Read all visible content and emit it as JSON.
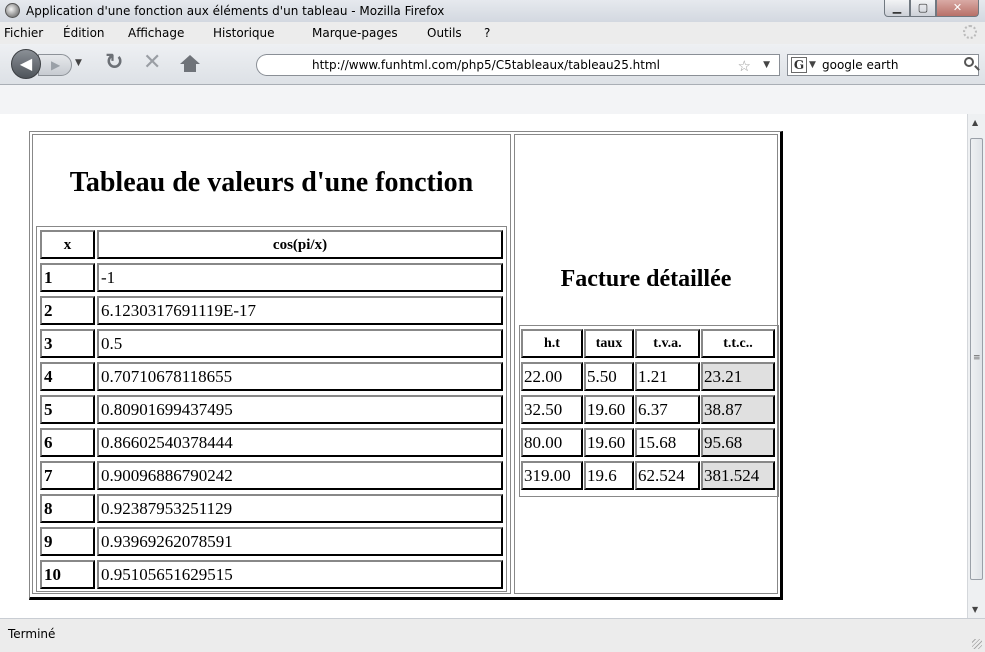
{
  "window": {
    "title": "Application d'une fonction aux éléments d'un tableau - Mozilla Firefox"
  },
  "menu": [
    "Fichier",
    "Édition",
    "Affichage",
    "Historique",
    "Marque-pages",
    "Outils",
    "?"
  ],
  "nav": {
    "url": "http://www.funhtml.com/php5/C5tableaux/tableau25.html",
    "search_engine": "G",
    "search_value": "google earth"
  },
  "content": {
    "function_table": {
      "caption": "Tableau de valeurs d'une fonction",
      "headers": [
        "x",
        "cos(pi/x)"
      ],
      "rows": [
        [
          "1",
          "-1"
        ],
        [
          "2",
          "6.1230317691119E-17"
        ],
        [
          "3",
          "0.5"
        ],
        [
          "4",
          "0.70710678118655"
        ],
        [
          "5",
          "0.80901699437495"
        ],
        [
          "6",
          "0.86602540378444"
        ],
        [
          "7",
          "0.90096886790242"
        ],
        [
          "8",
          "0.92387953251129"
        ],
        [
          "9",
          "0.93969262078591"
        ],
        [
          "10",
          "0.95105651629515"
        ]
      ]
    },
    "invoice_table": {
      "caption": "Facture détaillée",
      "headers": [
        "h.t",
        "taux",
        "t.v.a.",
        "t.t.c.."
      ],
      "rows": [
        [
          "22.00",
          "5.50",
          "1.21",
          "23.21"
        ],
        [
          "32.50",
          "19.60",
          "6.37",
          "38.87"
        ],
        [
          "80.00",
          "19.60",
          "15.68",
          "95.68"
        ],
        [
          "319.00",
          "19.6",
          "62.524",
          "381.524"
        ]
      ]
    }
  },
  "status": "Terminé"
}
